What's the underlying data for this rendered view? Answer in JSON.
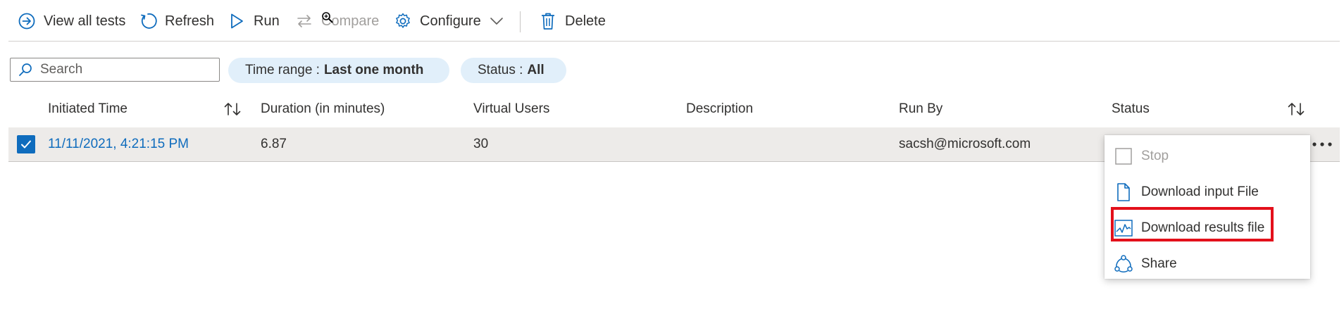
{
  "toolbar": {
    "view_all_tests": "View all tests",
    "refresh": "Refresh",
    "run": "Run",
    "compare": "Compare",
    "configure": "Configure",
    "delete": "Delete"
  },
  "filters": {
    "search_placeholder": "Search",
    "time_range_label": "Time range :",
    "time_range_value": "Last one month",
    "status_label": "Status :",
    "status_value": "All"
  },
  "table": {
    "columns": [
      "Initiated Time",
      "Duration (in minutes)",
      "Virtual Users",
      "Description",
      "Run By",
      "Status"
    ],
    "rows": [
      {
        "selected": true,
        "initiated_time": "11/11/2021, 4:21:15 PM",
        "duration": "6.87",
        "virtual_users": "30",
        "description": "",
        "run_by": "sacsh@microsoft.com",
        "status": ""
      }
    ]
  },
  "context_menu": {
    "items": [
      {
        "label": "Stop",
        "icon": "stop-checkbox-icon",
        "disabled": true
      },
      {
        "label": "Download input File",
        "icon": "document-icon",
        "disabled": false
      },
      {
        "label": "Download results file",
        "icon": "chart-icon",
        "disabled": false,
        "highlighted": true
      },
      {
        "label": "Share",
        "icon": "share-icon",
        "disabled": false
      }
    ]
  },
  "colors": {
    "accent": "#0f6cbd",
    "chip_bg": "#e1effa",
    "selected_row_bg": "#edebe9",
    "highlight_border": "#e3101b"
  }
}
